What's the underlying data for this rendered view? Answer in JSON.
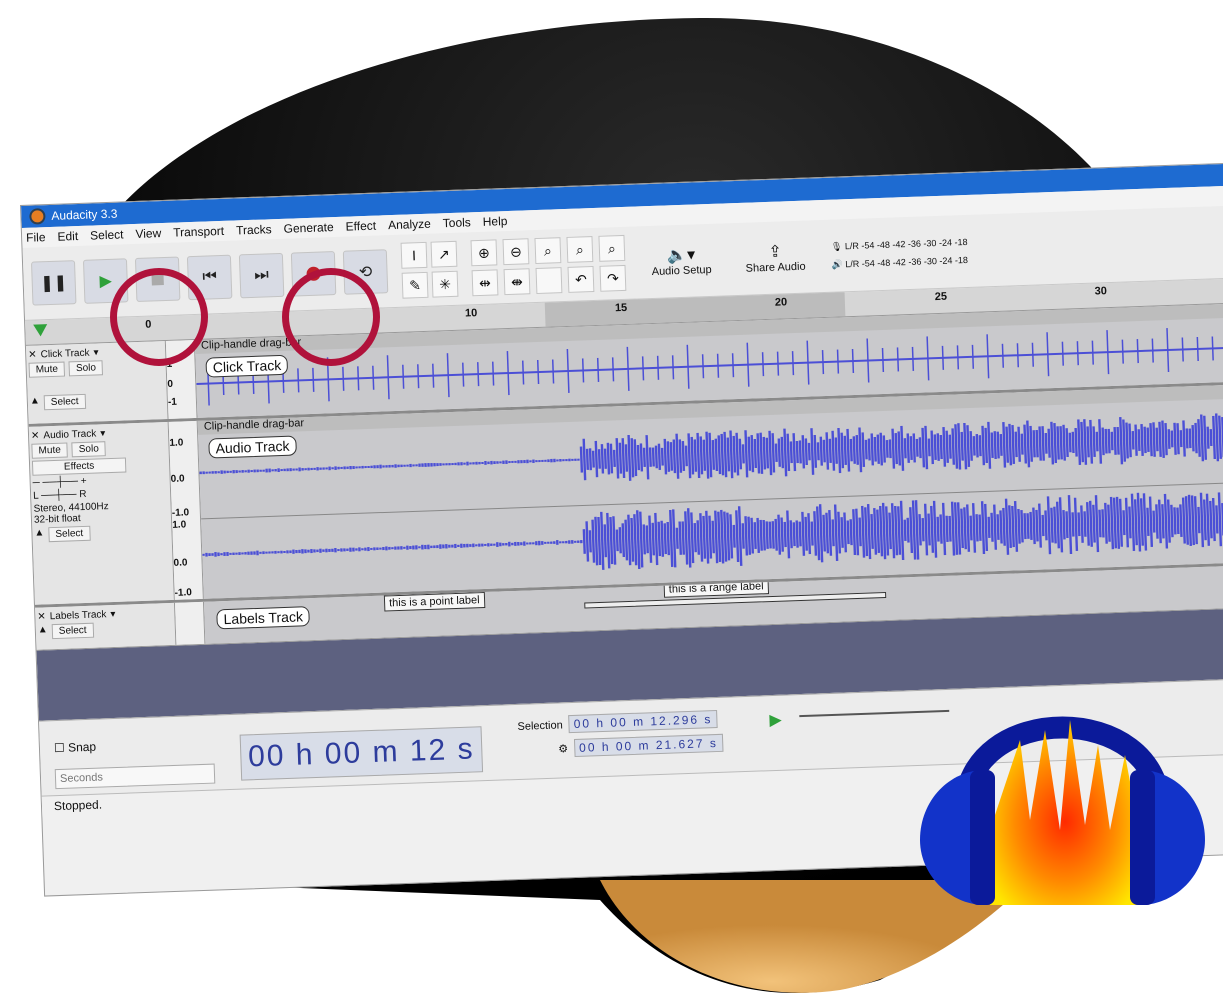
{
  "window": {
    "title": "Audacity 3.3"
  },
  "menu": [
    "File",
    "Edit",
    "Select",
    "View",
    "Transport",
    "Tracks",
    "Generate",
    "Effect",
    "Analyze",
    "Tools",
    "Help"
  ],
  "toolbar": {
    "audio_setup_label": "Audio Setup",
    "share_audio_label": "Share Audio",
    "meter_scale": [
      "-54",
      "-48",
      "-42",
      "-36",
      "-30",
      "-24",
      "-18"
    ]
  },
  "ruler": {
    "ticks": [
      "0",
      "10",
      "15",
      "20",
      "25",
      "30"
    ]
  },
  "tracks": {
    "click": {
      "name": "Click Track",
      "clip_header": "Clip-handle drag-bar",
      "label": "Click Track",
      "mute": "Mute",
      "solo": "Solo",
      "select": "Select",
      "scale": [
        "1",
        "0",
        "-1"
      ]
    },
    "audio": {
      "name": "Audio Track",
      "clip_header": "Clip-handle drag-bar",
      "label": "Audio Track",
      "mute": "Mute",
      "solo": "Solo",
      "effects": "Effects",
      "info": "Stereo, 44100Hz",
      "format": "32-bit float",
      "select": "Select",
      "scale": [
        "1.0",
        "0.0",
        "-1.0"
      ]
    },
    "labels": {
      "name": "Labels Track",
      "label": "Labels Track",
      "select": "Select",
      "point_label": "this is a point label",
      "range_label": "this is a range label"
    }
  },
  "bottom": {
    "snap_label": "Snap",
    "snap_unit": "Seconds",
    "time": "00 h 00 m 12 s",
    "selection_label": "Selection",
    "sel_start": "00 h 00 m 12.296 s",
    "sel_end": "00 h 00 m 21.627 s",
    "status": "Stopped."
  },
  "colors": {
    "accent": "#1e6bd1",
    "highlight_circle": "#b0123b",
    "waveform": "#4b4fd6",
    "record": "#c0202a"
  }
}
